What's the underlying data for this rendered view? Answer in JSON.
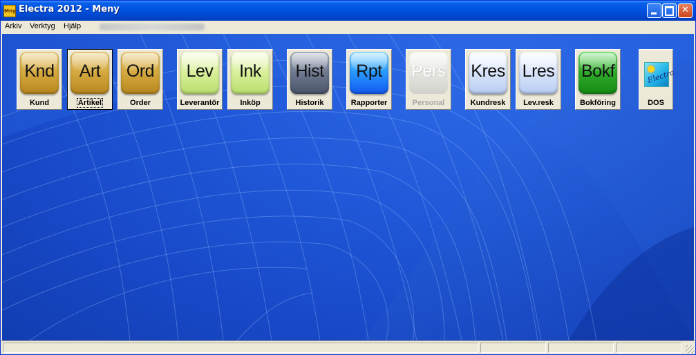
{
  "window": {
    "title": "Electra 2012 - Meny",
    "icon_text": "Mny",
    "minimize_icon": "minimize-icon",
    "maximize_icon": "maximize-icon",
    "close_glyph": "✕"
  },
  "menubar": {
    "items": [
      {
        "label": "Arkiv"
      },
      {
        "label": "Verktyg"
      },
      {
        "label": "Hjälp"
      }
    ]
  },
  "modules": [
    {
      "abbr": "Knd",
      "label": "Kund",
      "color": "gold"
    },
    {
      "abbr": "Art",
      "label": "Artikel",
      "color": "gold",
      "selected": true
    },
    {
      "abbr": "Ord",
      "label": "Order",
      "color": "gold"
    },
    {
      "abbr": "Lev",
      "label": "Leverantör",
      "color": "lime"
    },
    {
      "abbr": "Ink",
      "label": "Inköp",
      "color": "lime"
    },
    {
      "abbr": "Hist",
      "label": "Historik",
      "color": "slate"
    },
    {
      "abbr": "Rpt",
      "label": "Rapporter",
      "color": "blue"
    },
    {
      "abbr": "Pers",
      "label": "Personal",
      "color": "gray",
      "disabled": true
    },
    {
      "abbr": "Kres",
      "label": "Kundresk",
      "color": "pale"
    },
    {
      "abbr": "Lres",
      "label": "Lev.resk",
      "color": "pale"
    },
    {
      "abbr": "Bokf",
      "label": "Bokföring",
      "color": "green"
    },
    {
      "abbr": "",
      "label": "DOS",
      "icon": "electra-dos-icon",
      "icon_text": "Electra"
    }
  ],
  "colors": {
    "titlebar": "#0054e3",
    "desktop": "#1f58d8",
    "gold": "#d4a83e",
    "lime": "#d8f09a",
    "slate": "#6e7890",
    "blue": "#2a9dff",
    "gray": "#e2e2dc",
    "pale": "#d6e2fa",
    "green": "#2eaa2a"
  }
}
